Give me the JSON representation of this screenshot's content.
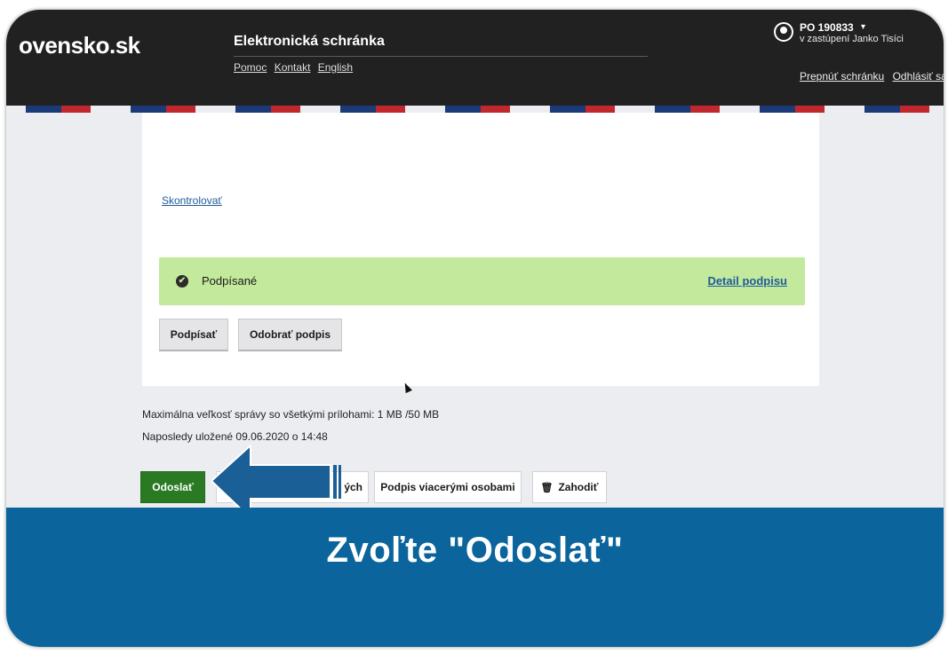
{
  "header": {
    "brand": "ovensko.sk",
    "app_title": "Elektronická schránka",
    "help_links": [
      "Pomoc",
      "Kontakt",
      "English"
    ],
    "user_id": "PO 190833",
    "user_caret": "▾",
    "user_sub": "v zastúpení Janko Tisíci",
    "links": [
      "Prepnúť schránku",
      "Odhlásiť sa"
    ]
  },
  "panel": {
    "check_link": "Skontrolovať",
    "signed_icon": "✔",
    "signed_label": "Podpísané",
    "detail_link": "Detail podpisu",
    "sign_button": "Podpísať",
    "unsign_button": "Odobrať podpis"
  },
  "info": {
    "max_size": "Maximálna veľkosť správy so všetkými prílohami: 1 MB /50 MB",
    "last_saved": "Naposledy uložené 09.06.2020 o 14:48"
  },
  "actions": {
    "send": "Odoslať",
    "hidden_partial": "ých",
    "multi_sign": "Podpis viacerými osobami",
    "discard_icon": "🗑",
    "discard": "Zahodiť"
  },
  "caption": "Zvoľte \"Odoslať\"",
  "colors": {
    "header_bg": "#212121",
    "signed_bg": "#c3e99c",
    "send_bg": "#2a7a23",
    "banner_bg": "#0b649b",
    "arrow": "#1a5f96",
    "link": "#1f5c99"
  }
}
